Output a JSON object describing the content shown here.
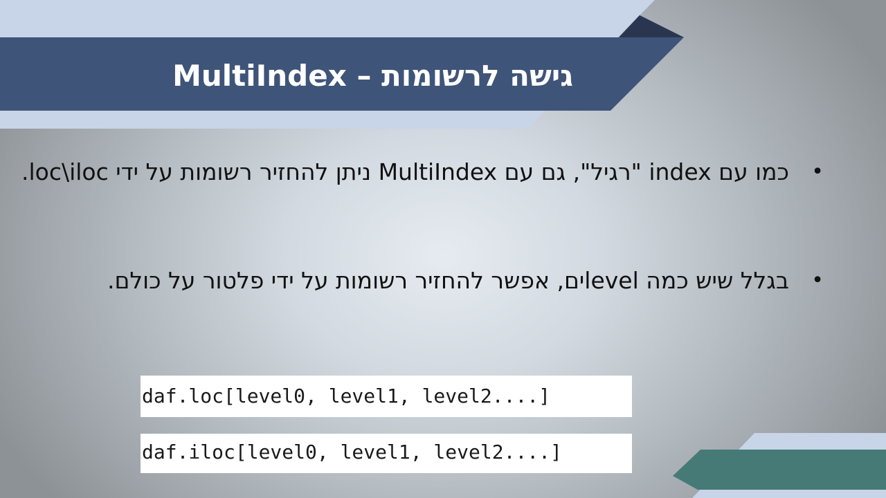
{
  "title": "גישה לרשומות – MultiIndex",
  "bullets": [
    {
      "symbol": "•",
      "text": "כמו עם index \"רגיל\", גם עם MultiIndex ניתן להחזיר רשומות על ידי loc\\iloc."
    },
    {
      "symbol": "•",
      "text": "בגלל שיש כמה levelים, אפשר להחזיר רשומות על ידי פלטור על כולם."
    }
  ],
  "code": [
    "daf.loc[level0, level1, level2....]",
    "daf.iloc[level0, level1, level2....]"
  ],
  "colors": {
    "title_band": "#3f5479",
    "light_band": "#c8d4e7",
    "dark_triangle": "#2a3550",
    "teal_band": "#467a76"
  }
}
